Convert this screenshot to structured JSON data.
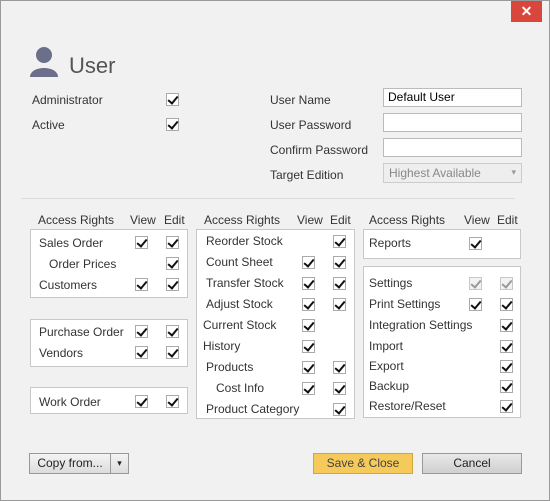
{
  "window": {
    "close_glyph": "✕",
    "title": "User"
  },
  "general": {
    "administrator_label": "Administrator",
    "administrator_checked": true,
    "active_label": "Active",
    "active_checked": true
  },
  "credentials": {
    "username_label": "User Name",
    "username_value": "Default User",
    "password_label": "User Password",
    "password_value": "",
    "confirm_label": "Confirm Password",
    "confirm_value": "",
    "edition_label": "Target Edition",
    "edition_value": "Highest Available"
  },
  "headers": {
    "access_rights": "Access Rights",
    "view": "View",
    "edit": "Edit"
  },
  "col1": {
    "sales_order": "Sales Order",
    "order_prices": "Order Prices",
    "customers": "Customers",
    "purchase_order": "Purchase Order",
    "vendors": "Vendors",
    "work_order": "Work Order"
  },
  "col2": {
    "reorder_stock": "Reorder Stock",
    "count_sheet": "Count Sheet",
    "transfer_stock": "Transfer Stock",
    "adjust_stock": "Adjust Stock",
    "current_stock": "Current Stock",
    "history": "History",
    "products": "Products",
    "cost_info": "Cost Info",
    "product_category": "Product Category"
  },
  "col3": {
    "reports": "Reports",
    "settings": "Settings",
    "print_settings": "Print Settings",
    "integration_settings": "Integration Settings",
    "import": "Import",
    "export": "Export",
    "backup": "Backup",
    "restore_reset": "Restore/Reset"
  },
  "footer": {
    "copy_from": "Copy from...",
    "copy_arrow": "▾",
    "save_close": "Save & Close",
    "cancel": "Cancel"
  },
  "colors": {
    "accent_save": "#f5c95a",
    "close": "#d9463b"
  }
}
